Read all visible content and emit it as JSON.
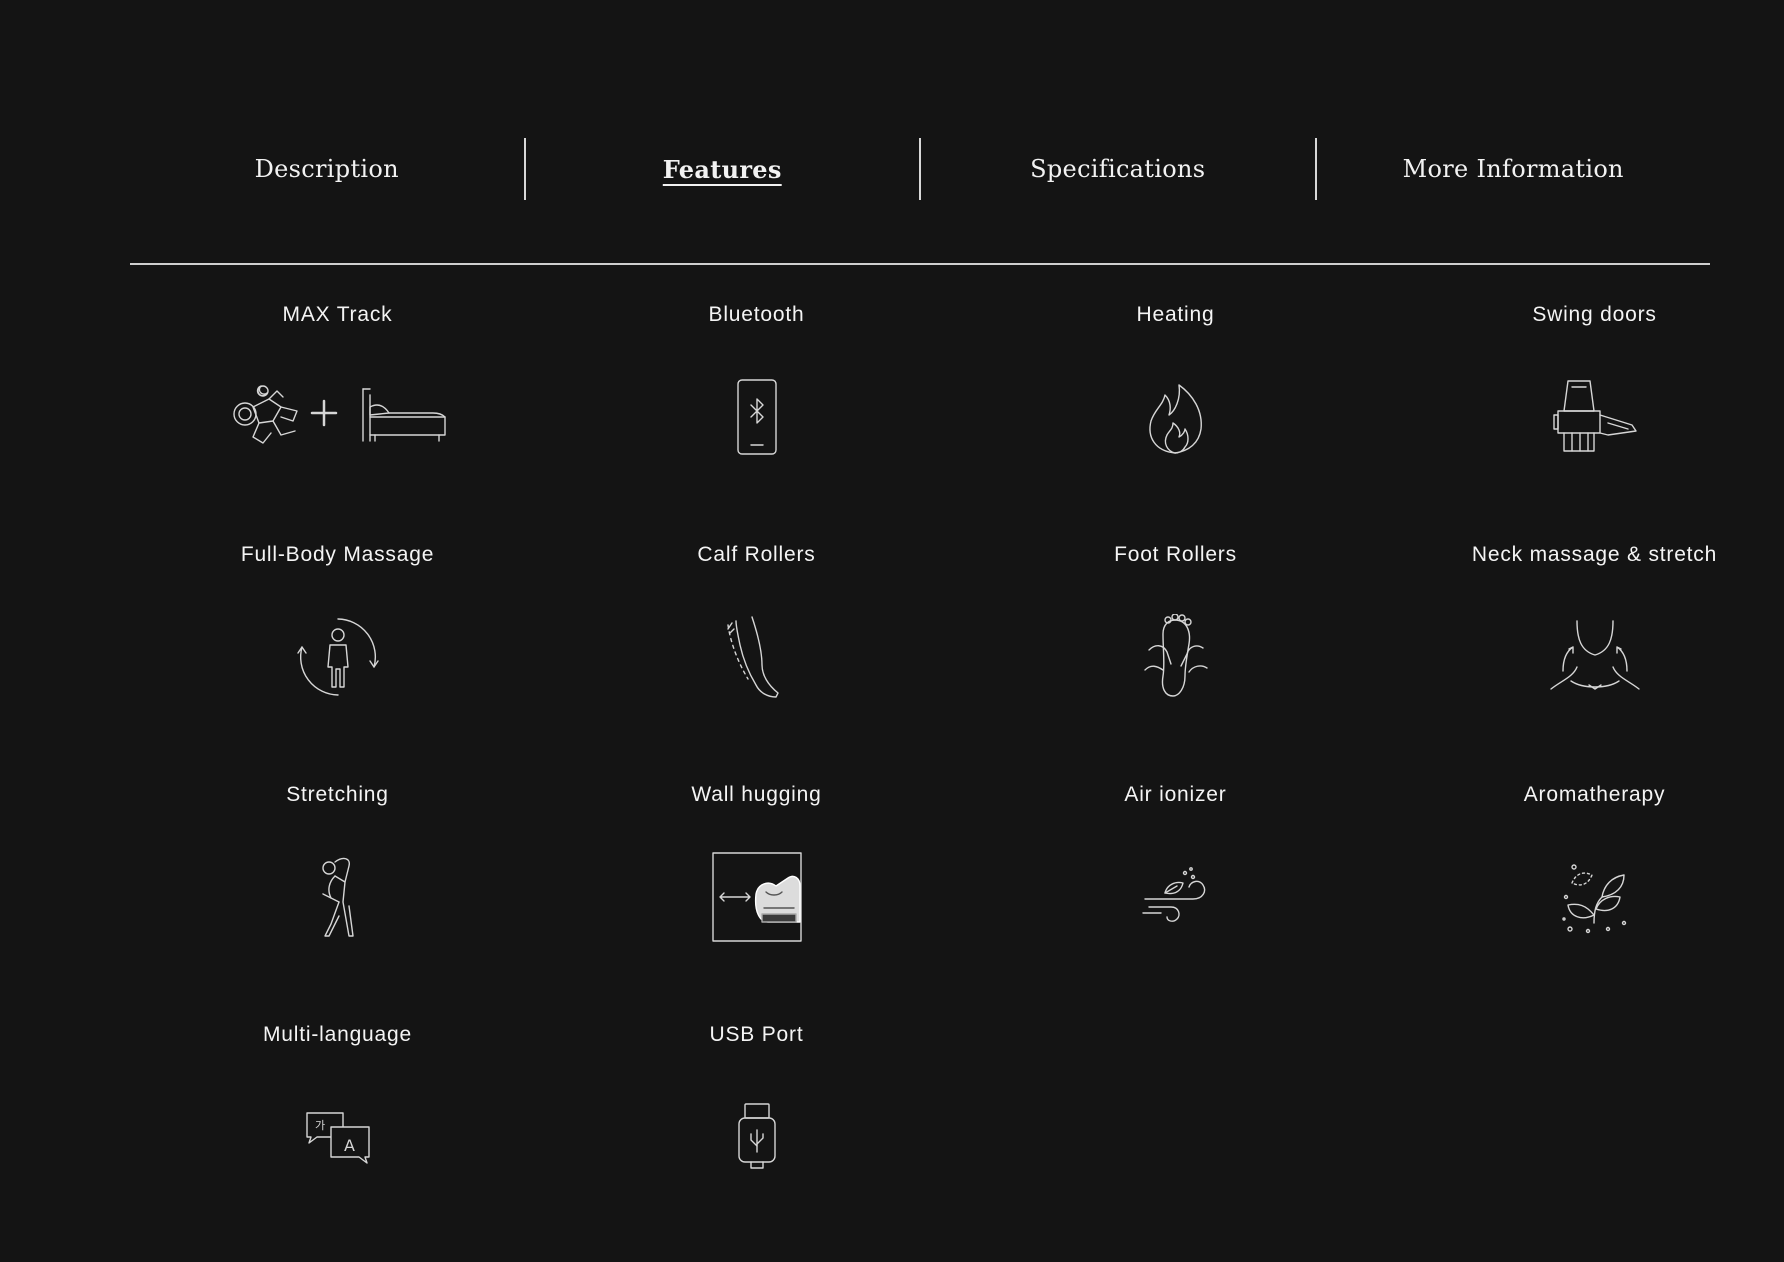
{
  "tabs": [
    {
      "label": "Description",
      "active": false
    },
    {
      "label": "Features",
      "active": true
    },
    {
      "label": "Specifications",
      "active": false
    },
    {
      "label": "More Information",
      "active": false
    }
  ],
  "features": [
    {
      "label": "MAX Track",
      "icon": "astronaut-plus-bed-icon"
    },
    {
      "label": "Bluetooth",
      "icon": "bluetooth-phone-icon"
    },
    {
      "label": "Heating",
      "icon": "flame-icon"
    },
    {
      "label": "Swing doors",
      "icon": "massage-chair-door-icon"
    },
    {
      "label": "Full-Body Massage",
      "icon": "person-rotate-icon"
    },
    {
      "label": "Calf Rollers",
      "icon": "leg-icon"
    },
    {
      "label": "Foot Rollers",
      "icon": "foot-hands-icon"
    },
    {
      "label": "Neck massage & stretch",
      "icon": "neck-arrows-icon"
    },
    {
      "label": "Stretching",
      "icon": "person-stretch-icon"
    },
    {
      "label": "Wall hugging",
      "icon": "chair-wall-arrow-icon"
    },
    {
      "label": "Air ionizer",
      "icon": "wind-leaf-icon"
    },
    {
      "label": "Aromatherapy",
      "icon": "leaves-icon"
    },
    {
      "label": "Multi-language",
      "icon": "speech-bubbles-icon"
    },
    {
      "label": "USB Port",
      "icon": "usb-icon"
    }
  ]
}
